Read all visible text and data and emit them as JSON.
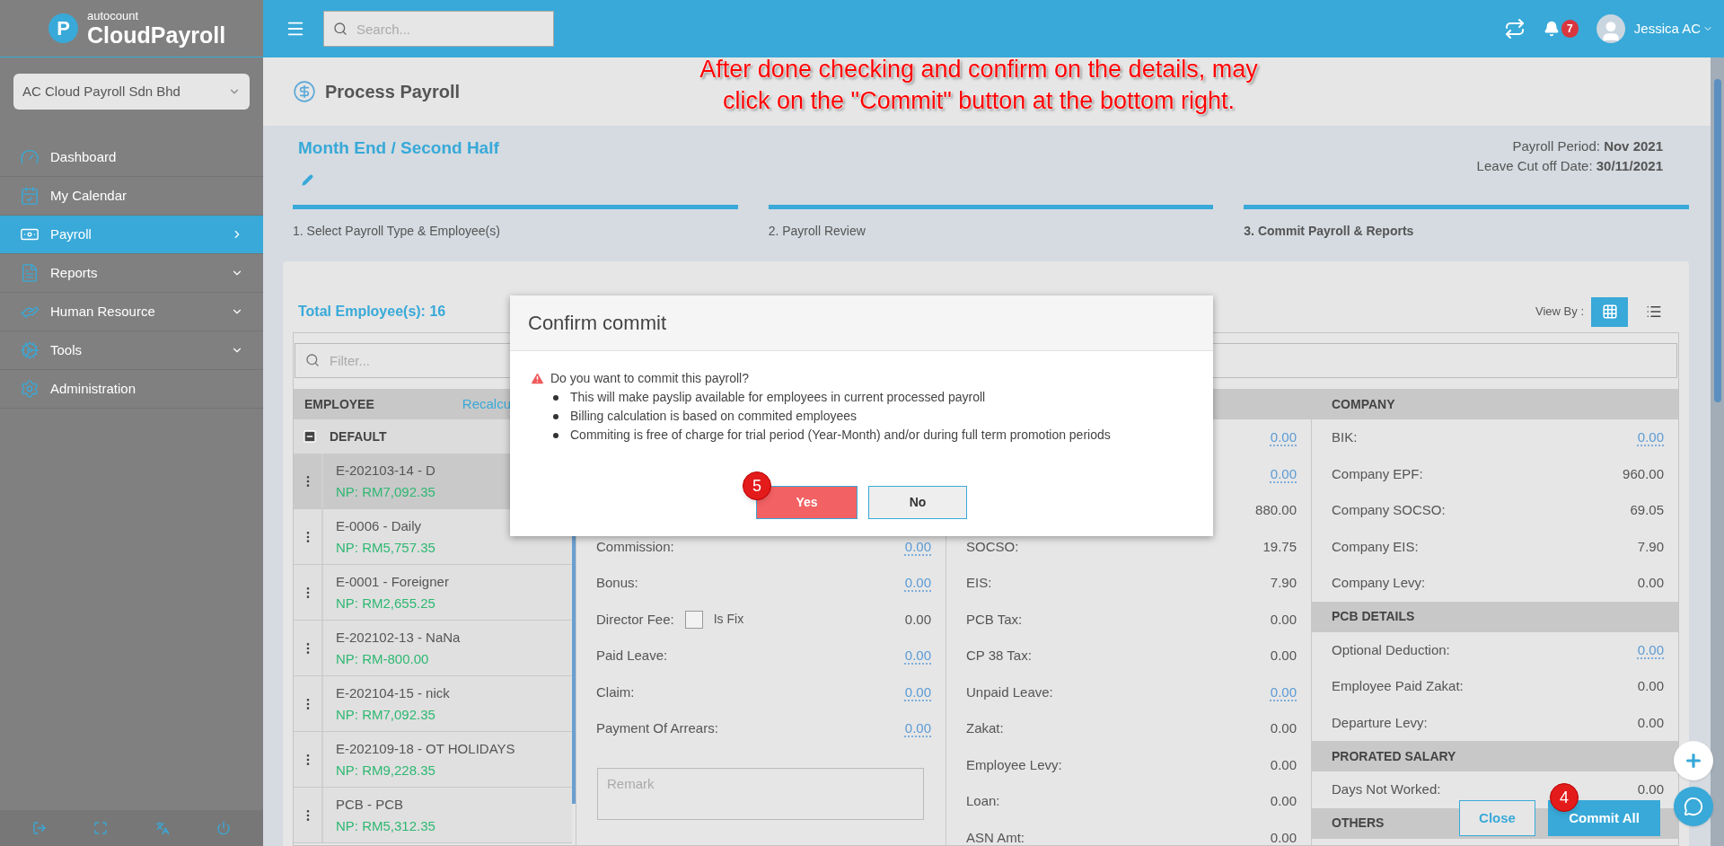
{
  "brand": {
    "mark": "P",
    "small": "autocount",
    "name": "CloudPayroll"
  },
  "company_select": {
    "value": "AC Cloud Payroll Sdn Bhd"
  },
  "sidebar": {
    "items": [
      {
        "label": "Dashboard",
        "selected": false,
        "expandable": false
      },
      {
        "label": "My Calendar",
        "selected": false,
        "expandable": false
      },
      {
        "label": "Payroll",
        "selected": true,
        "expandable": true
      },
      {
        "label": "Reports",
        "selected": false,
        "expandable": true
      },
      {
        "label": "Human Resource",
        "selected": false,
        "expandable": true
      },
      {
        "label": "Tools",
        "selected": false,
        "expandable": true
      },
      {
        "label": "Administration",
        "selected": false,
        "expandable": false
      }
    ]
  },
  "topbar": {
    "search_placeholder": "Search...",
    "notification_count": "7",
    "user": "Jessica AC"
  },
  "page": {
    "title": "Process Payroll"
  },
  "annotation": [
    "After done checking and confirm on the details, may",
    "click on the \"Commit\" button at the bottom right."
  ],
  "payroll": {
    "type": "Month End / Second Half",
    "period": "Payroll Period: **Nov 2021**",
    "cutoff": "Leave Cut off Date: **30/11/2021**"
  },
  "steps": [
    {
      "label": "1. Select Payroll Type & Employee(s)",
      "selected": false
    },
    {
      "label": "2. Payroll Review",
      "selected": false
    },
    {
      "label": "3. Commit Payroll & Reports",
      "selected": true
    }
  ],
  "total_employees": "Total Employee(s): 16",
  "view_by": {
    "label": "View By :",
    "options": [
      {
        "kind": "grid",
        "selected": true
      },
      {
        "kind": "list",
        "selected": false
      }
    ]
  },
  "filter": {
    "placeholder": "Filter..."
  },
  "employee_panel": {
    "header": "EMPLOYEE",
    "recalc": "Recalcu",
    "group": "DEFAULT",
    "expanded": true,
    "employees": [
      {
        "name": "E-202103-14 - D",
        "net": "NP: RM7,092.35",
        "selected": true
      },
      {
        "name": "E-0006 - Daily",
        "net": "NP: RM5,757.35",
        "selected": false
      },
      {
        "name": "E-0001 - Foreigner",
        "net": "NP: RM2,655.25",
        "selected": false
      },
      {
        "name": "E-202102-13 - NaNa",
        "net": "NP: RM-800.00",
        "selected": false
      },
      {
        "name": "E-202104-15 - nick",
        "net": "NP: RM7,092.35",
        "selected": false
      },
      {
        "name": "E-202109-18 - OT HOLIDAYS",
        "net": "NP: RM9,228.35",
        "selected": false
      },
      {
        "name": "PCB - PCB",
        "net": "NP: RM5,312.35",
        "selected": false
      }
    ]
  },
  "earnings": {
    "rows": [
      {
        "kind": "amount",
        "label": "Commission:",
        "value": "0.00",
        "link": true
      },
      {
        "kind": "amount",
        "label": "Bonus:",
        "value": "0.00",
        "link": true
      },
      {
        "kind": "fix",
        "label": "Director Fee:",
        "fix_label": "Is Fix",
        "checked": false,
        "value": "0.00",
        "link": false
      },
      {
        "kind": "amount",
        "label": "Paid Leave:",
        "value": "0.00",
        "link": true
      },
      {
        "kind": "amount",
        "label": "Claim:",
        "value": "0.00",
        "link": true
      },
      {
        "kind": "amount",
        "label": "Payment Of Arrears:",
        "value": "0.00",
        "link": true
      }
    ],
    "remark_placeholder": "Remark"
  },
  "deductions": {
    "rows": [
      {
        "value": "0.00",
        "link": true
      },
      {
        "value": "0.00",
        "link": true
      },
      {
        "value": "880.00",
        "link": false
      },
      {
        "label": "SOCSO:",
        "value": "19.75",
        "link": false
      },
      {
        "label": "EIS:",
        "value": "7.90",
        "link": false
      },
      {
        "label": "PCB Tax:",
        "value": "0.00",
        "link": false
      },
      {
        "label": "CP 38 Tax:",
        "value": "0.00",
        "link": false
      },
      {
        "label": "Unpaid Leave:",
        "value": "0.00",
        "link": true
      },
      {
        "label": "Zakat:",
        "value": "0.00",
        "link": false
      },
      {
        "label": "Employee Levy:",
        "value": "0.00",
        "link": false
      },
      {
        "label": "Loan:",
        "value": "0.00",
        "link": false
      },
      {
        "label": "ASN Amt:",
        "value": "0.00",
        "link": false
      }
    ]
  },
  "company": {
    "sections": [
      {
        "header": "COMPANY",
        "rows": [
          {
            "label": "BIK:",
            "value": "0.00",
            "link": true
          },
          {
            "label": "Company EPF:",
            "value": "960.00",
            "link": false
          },
          {
            "label": "Company SOCSO:",
            "value": "69.05",
            "link": false
          },
          {
            "label": "Company EIS:",
            "value": "7.90",
            "link": false
          },
          {
            "label": "Company Levy:",
            "value": "0.00",
            "link": false
          }
        ]
      },
      {
        "header": "PCB DETAILS",
        "rows": [
          {
            "label": "Optional Deduction:",
            "value": "0.00",
            "link": true
          },
          {
            "label": "Employee Paid Zakat:",
            "value": "0.00",
            "link": false
          },
          {
            "label": "Departure Levy:",
            "value": "0.00",
            "link": false
          }
        ]
      },
      {
        "header": "PRORATED SALARY",
        "rows": [
          {
            "label": "Days Not Worked:",
            "value": "0.00",
            "link": false
          }
        ]
      },
      {
        "header": "OTHERS"
      }
    ]
  },
  "actions": {
    "close": "Close",
    "commit": "Commit All",
    "commit_step": "4"
  },
  "dialog": {
    "title": "Confirm commit",
    "question": "Do you want to commit this payroll?",
    "bullets": [
      "This will make payslip available for employees in current processed payroll",
      "Billing calculation is based on commited employees",
      "Commiting is free of charge for trial period (Year-Month) and/or during full term promotion periods"
    ],
    "buttons": [
      {
        "label": "Yes",
        "kind": "danger",
        "step": "5"
      },
      {
        "label": "No",
        "kind": "default"
      }
    ]
  }
}
